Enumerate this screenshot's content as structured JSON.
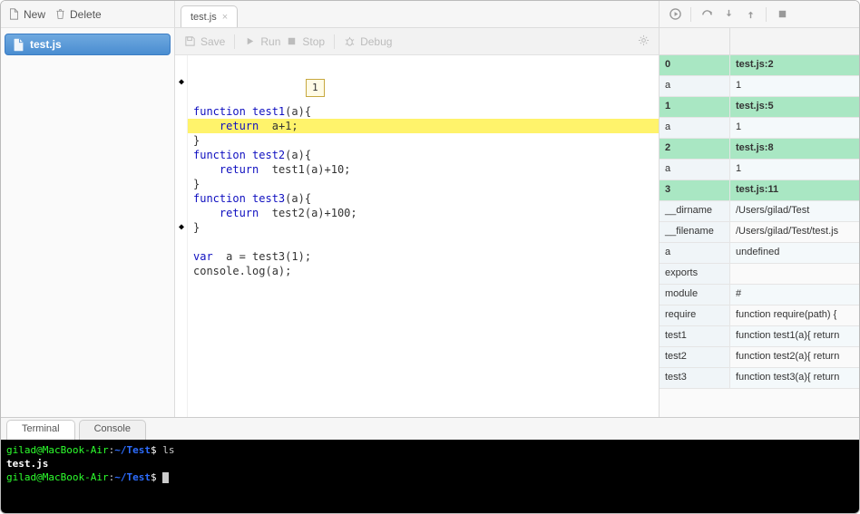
{
  "left": {
    "new_label": "New",
    "delete_label": "Delete",
    "files": [
      "test.js"
    ]
  },
  "tabs": [
    {
      "label": "test.js"
    }
  ],
  "editor_toolbar": {
    "save": "Save",
    "run": "Run",
    "stop": "Stop",
    "debug": "Debug"
  },
  "code": {
    "tooltip_value": "1",
    "lines": [
      {
        "kw": "function",
        "fn": "test1",
        "rest": "(a){"
      },
      {
        "indent": "    ",
        "kw": "return",
        "rest": " a+1;",
        "hl": true,
        "bp": true
      },
      {
        "rest": "}"
      },
      {
        "kw": "function",
        "fn": "test2",
        "rest": "(a){"
      },
      {
        "indent": "    ",
        "kw": "return",
        "rest": " test1(a)+10;"
      },
      {
        "rest": "}"
      },
      {
        "kw": "function",
        "fn": "test3",
        "rest": "(a){"
      },
      {
        "indent": "    ",
        "kw": "return",
        "rest": " test2(a)+100;"
      },
      {
        "rest": "}"
      },
      {
        "rest": ""
      },
      {
        "kw": "var",
        "rest": " a = test3(1);"
      },
      {
        "rest": "console.log(a);",
        "bp": true
      }
    ]
  },
  "vars": [
    {
      "k": "0",
      "v": "test.js:2",
      "frame": true
    },
    {
      "k": "a",
      "v": "1"
    },
    {
      "k": "1",
      "v": "test.js:5",
      "frame": true
    },
    {
      "k": "a",
      "v": "1"
    },
    {
      "k": "2",
      "v": "test.js:8",
      "frame": true
    },
    {
      "k": "a",
      "v": "1"
    },
    {
      "k": "3",
      "v": "test.js:11",
      "frame": true
    },
    {
      "k": "__dirname",
      "v": "/Users/gilad/Test"
    },
    {
      "k": "__filename",
      "v": "/Users/gilad/Test/test.js"
    },
    {
      "k": "a",
      "v": "undefined"
    },
    {
      "k": "exports",
      "v": ""
    },
    {
      "k": "module",
      "v": "#"
    },
    {
      "k": "require",
      "v": "function require(path) { "
    },
    {
      "k": "test1",
      "v": "function test1(a){ return"
    },
    {
      "k": "test2",
      "v": "function test2(a){ return"
    },
    {
      "k": "test3",
      "v": "function test3(a){ return"
    }
  ],
  "bottom": {
    "tab_terminal": "Terminal",
    "tab_console": "Console",
    "prompt_user": "gilad",
    "prompt_host": "MacBook-Air",
    "prompt_path": "~/Test",
    "cmd1": "ls",
    "out1": "test.js"
  }
}
